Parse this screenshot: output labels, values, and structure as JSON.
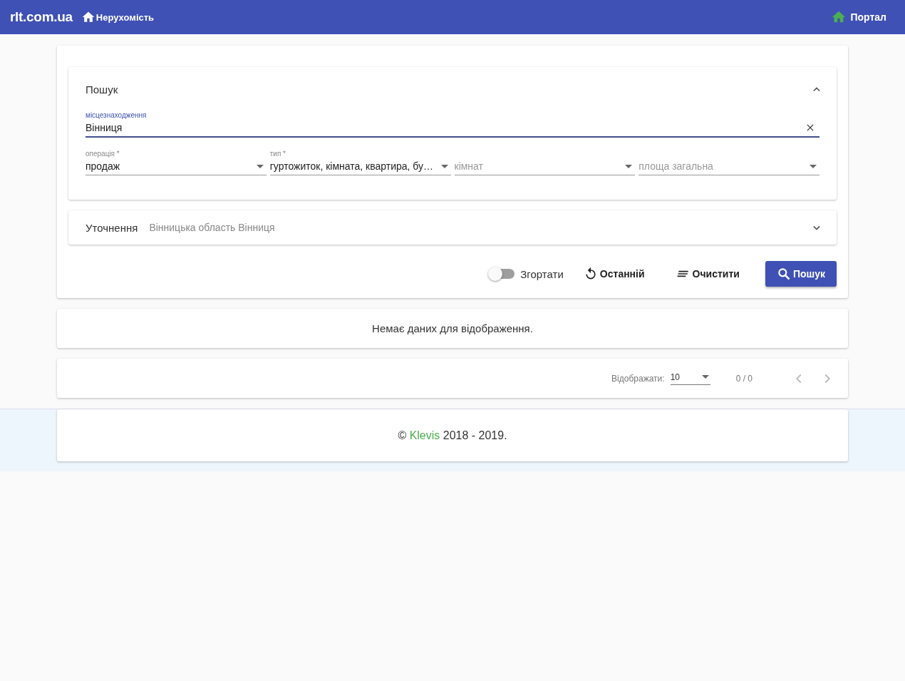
{
  "header": {
    "brand": "rlt.com.ua",
    "nav": [
      {
        "label": "Нерухомість"
      }
    ],
    "portal": "Портал"
  },
  "search_panel": {
    "title": "Пошук",
    "expanded": true,
    "location": {
      "label": "місцезнаходження",
      "value": "Вінниця"
    },
    "selects": [
      {
        "label": "операція *",
        "value": "продаж"
      },
      {
        "label": "тип *",
        "value": "гуртожиток, кімната, квартира, бу…"
      },
      {
        "placeholder": "кімнат"
      },
      {
        "placeholder": "площа загальна"
      }
    ]
  },
  "refine_panel": {
    "title": "Уточнення",
    "value": "Вінницька область Вінниця",
    "expanded": false
  },
  "actions": {
    "toggle": {
      "label": "Згортати",
      "on": false
    },
    "buttons": [
      {
        "label": "Останній",
        "kind": "history"
      },
      {
        "label": "Очистити",
        "kind": "clear"
      },
      {
        "label": "Пошук",
        "kind": "search"
      }
    ]
  },
  "empty_message": "Немає даних для відображення.",
  "pagination": {
    "label": "Відображати:",
    "page_size": "10",
    "range": "0 / 0",
    "prev_disabled": true,
    "next_disabled": true
  },
  "footer": {
    "prefix": "©",
    "link": "Klevis",
    "suffix": "2018 - 2019."
  }
}
